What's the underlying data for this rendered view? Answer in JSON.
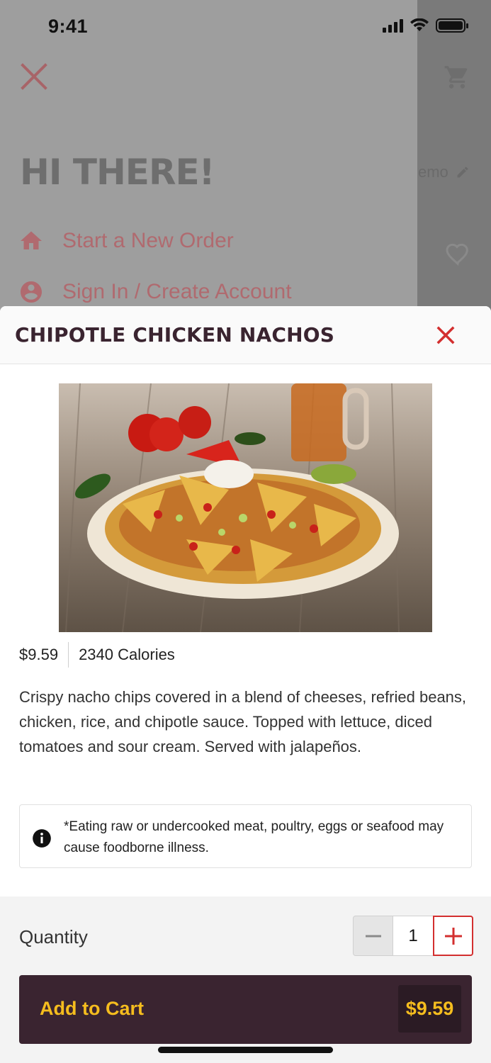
{
  "status_bar": {
    "time": "9:41"
  },
  "drawer": {
    "greeting": "HI THERE!",
    "memo_text": "emo",
    "items": [
      {
        "label": "Start a New Order",
        "icon": "home-icon"
      },
      {
        "label": "Sign In / Create Account",
        "icon": "account-circle-icon"
      }
    ]
  },
  "item_modal": {
    "title": "CHIPOTLE CHICKEN NACHOS",
    "price": "$9.59",
    "calories": "2340 Calories",
    "description": "Crispy nacho chips covered in a blend of cheeses, refried beans, chicken, rice, and chipotle sauce. Topped with lettuce, diced tomatoes and sour cream. Served with jalapeños.",
    "notice": "*Eating raw or undercooked meat, poultry, eggs or seafood may cause foodborne illness.",
    "quantity_label": "Quantity",
    "quantity": "1",
    "add_to_cart_label": "Add to Cart",
    "add_to_cart_price": "$9.59"
  },
  "colors": {
    "brand_dark": "#3a2430",
    "accent_yellow": "#f5bd1e",
    "close_red": "#d32f2f"
  }
}
